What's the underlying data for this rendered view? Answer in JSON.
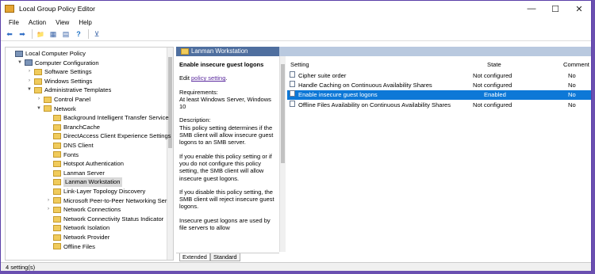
{
  "window": {
    "title": "Local Group Policy Editor",
    "minimize": "—",
    "maximize": "☐",
    "close": "✕"
  },
  "menu": [
    "File",
    "Action",
    "View",
    "Help"
  ],
  "toolbar": {
    "back": "⬅",
    "forward": "➡",
    "up": "📁",
    "show_tree": "▦",
    "help": "?",
    "properties": "▤",
    "filter": "⊻"
  },
  "tree": [
    {
      "label": "Local Computer Policy",
      "level": 0,
      "expander": "",
      "icon": "pc"
    },
    {
      "label": "Computer Configuration",
      "level": 1,
      "expander": "▼",
      "icon": "pc"
    },
    {
      "label": "Software Settings",
      "level": 2,
      "expander": "›",
      "icon": "folder"
    },
    {
      "label": "Windows Settings",
      "level": 2,
      "expander": "›",
      "icon": "folder"
    },
    {
      "label": "Administrative Templates",
      "level": 2,
      "expander": "▼",
      "icon": "folder"
    },
    {
      "label": "Control Panel",
      "level": 3,
      "expander": "›",
      "icon": "folder"
    },
    {
      "label": "Network",
      "level": 3,
      "expander": "▼",
      "icon": "folder"
    },
    {
      "label": "Background Intelligent Transfer Service",
      "level": 4,
      "expander": "",
      "icon": "folder"
    },
    {
      "label": "BranchCache",
      "level": 4,
      "expander": "",
      "icon": "folder"
    },
    {
      "label": "DirectAccess Client Experience Settings",
      "level": 4,
      "expander": "",
      "icon": "folder"
    },
    {
      "label": "DNS Client",
      "level": 4,
      "expander": "",
      "icon": "folder"
    },
    {
      "label": "Fonts",
      "level": 4,
      "expander": "",
      "icon": "folder"
    },
    {
      "label": "Hotspot Authentication",
      "level": 4,
      "expander": "",
      "icon": "folder"
    },
    {
      "label": "Lanman Server",
      "level": 4,
      "expander": "",
      "icon": "folder"
    },
    {
      "label": "Lanman Workstation",
      "level": 4,
      "expander": "",
      "icon": "folder",
      "selected": true
    },
    {
      "label": "Link-Layer Topology Discovery",
      "level": 4,
      "expander": "",
      "icon": "folder"
    },
    {
      "label": "Microsoft Peer-to-Peer Networking Ser",
      "level": 4,
      "expander": "›",
      "icon": "folder"
    },
    {
      "label": "Network Connections",
      "level": 4,
      "expander": "›",
      "icon": "folder"
    },
    {
      "label": "Network Connectivity Status Indicator",
      "level": 4,
      "expander": "",
      "icon": "folder"
    },
    {
      "label": "Network Isolation",
      "level": 4,
      "expander": "",
      "icon": "folder"
    },
    {
      "label": "Network Provider",
      "level": 4,
      "expander": "",
      "icon": "folder"
    },
    {
      "label": "Offline Files",
      "level": 4,
      "expander": "",
      "icon": "folder"
    }
  ],
  "pane_header": "Lanman Workstation",
  "description": {
    "title": "Enable insecure guest logons",
    "edit_prefix": "Edit ",
    "edit_link": "policy setting",
    "edit_suffix": ".",
    "requirements": "Requirements:",
    "requirements_value": "At least Windows Server, Windows 10",
    "description_label": "Description:",
    "p1": "This policy setting determines if the SMB client will allow insecure guest logons to an SMB server.",
    "p2": "If you enable this policy setting or if you do not configure this policy setting, the SMB client will allow insecure guest logons.",
    "p3": "If you disable this policy setting, the SMB client will reject insecure guest logons.",
    "p4": "Insecure guest logons are used by file servers to allow"
  },
  "list": {
    "columns": {
      "setting": "Setting",
      "state": "State",
      "comment": "Comment"
    },
    "rows": [
      {
        "setting": "Cipher suite order",
        "state": "Not configured",
        "comment": "No"
      },
      {
        "setting": "Handle Caching on Continuous Availability Shares",
        "state": "Not configured",
        "comment": "No"
      },
      {
        "setting": "Enable insecure guest logons",
        "state": "Enabled",
        "comment": "No",
        "selected": true
      },
      {
        "setting": "Offline Files Availability on Continuous Availability Shares",
        "state": "Not configured",
        "comment": "No"
      }
    ]
  },
  "tabs": [
    "Extended",
    "Standard"
  ],
  "status": "4 setting(s)"
}
